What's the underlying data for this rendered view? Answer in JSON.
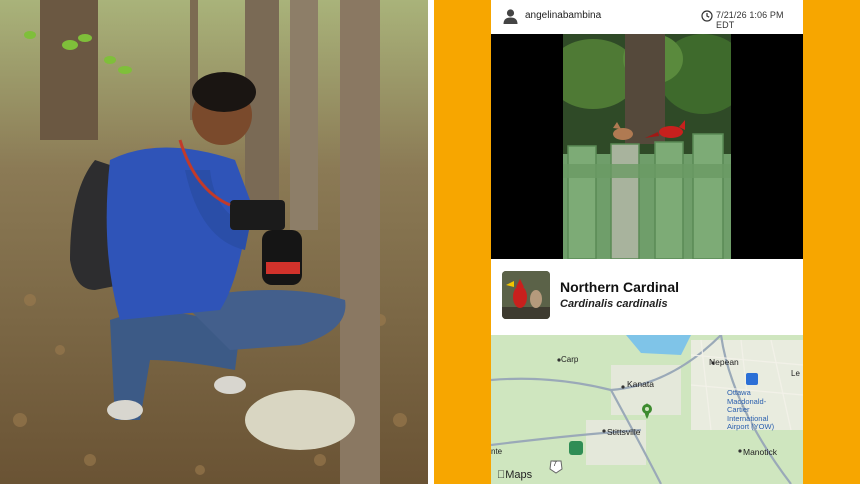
{
  "observation": {
    "username": "angelinabambina",
    "timestamp": "7/21/26 1:06 PM EDT",
    "icons": {
      "user": "user-icon",
      "clock": "clock-icon"
    }
  },
  "species": {
    "common_name": "Northern Cardinal",
    "scientific_name": "Cardinalis cardinalis"
  },
  "map": {
    "labels": {
      "carp": "Carp",
      "nepean": "Nepean",
      "kanata": "Kanata",
      "stittsville": "Stittsville",
      "airport": "Ottawa\nMacdonald-\nCartier\nInternational\nAirport (YOW)",
      "manotick": "Manotick",
      "road_7": "7",
      "edge_left": "nte",
      "edge_right": "Le"
    },
    "attribution": "Maps"
  },
  "colors": {
    "accent_orange": "#f7a600",
    "map_green": "#cfe6bf",
    "pin_green": "#3d8b2f",
    "cardinal_red": "#c8201d"
  }
}
